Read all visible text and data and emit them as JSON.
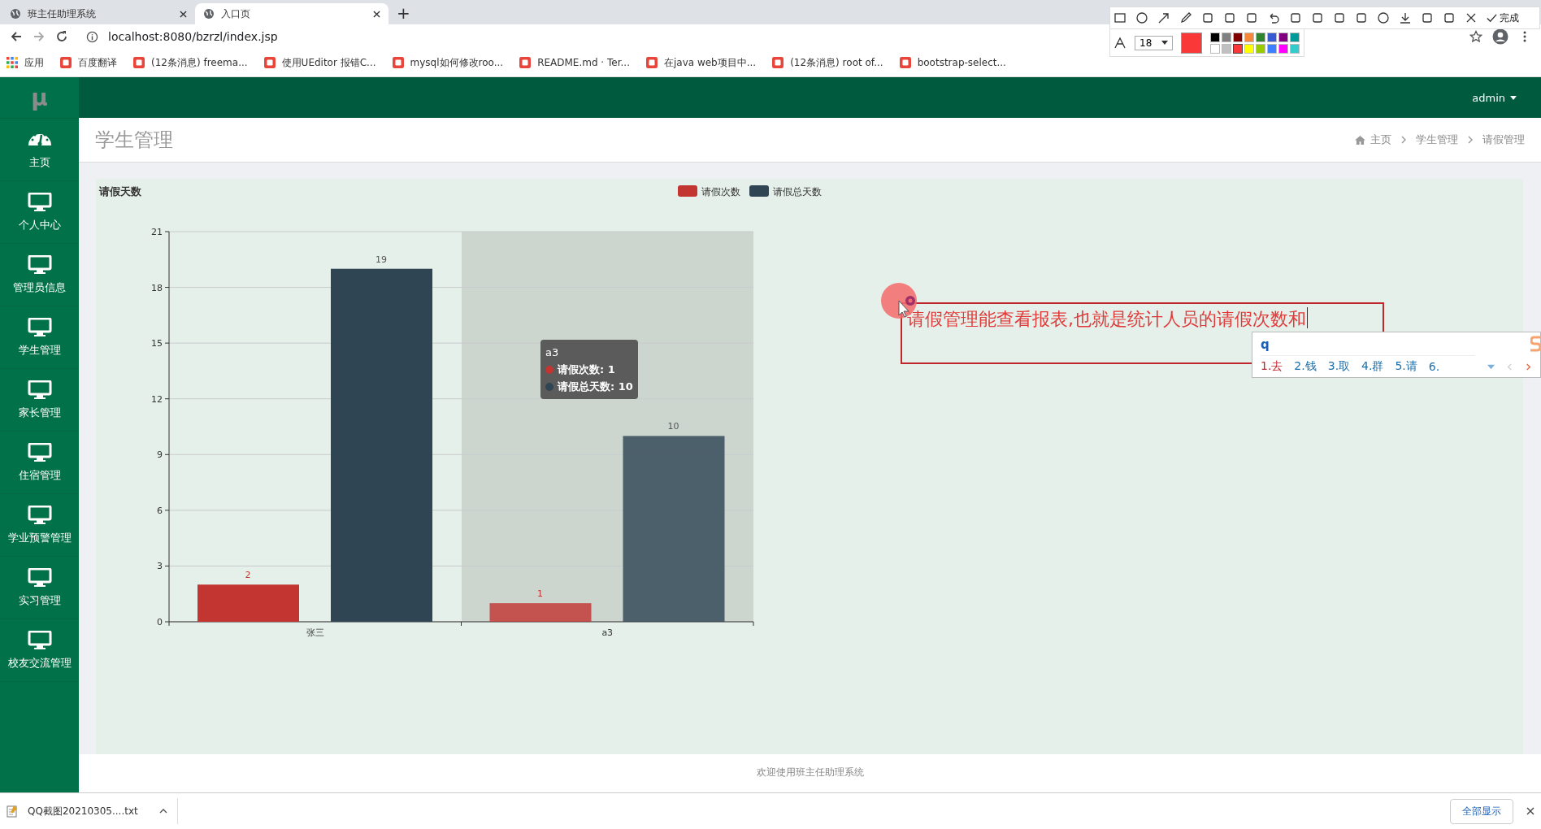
{
  "browser": {
    "tabs": [
      {
        "title": "班主任助理系统",
        "selected": false
      },
      {
        "title": "入口页",
        "selected": true
      }
    ],
    "new_tab": "+",
    "url": "localhost:8080/bzrzl/index.jsp",
    "bookmarks": [
      "应用",
      "百度翻译",
      "(12条消息) freema...",
      "使用UEditor 报错C...",
      "mysql如何修改roo...",
      "README.md · Ter...",
      "在java web项目中...",
      "(12条消息) root of...",
      "bootstrap-select..."
    ]
  },
  "capture_toolbar": {
    "font_size": "18",
    "done": "完成",
    "palette": [
      {
        "color": "#000000",
        "selected": false
      },
      {
        "color": "#808080",
        "selected": false
      },
      {
        "color": "#800000",
        "selected": false
      },
      {
        "color": "#f7883a",
        "selected": false
      },
      {
        "color": "#308430",
        "selected": false
      },
      {
        "color": "#385ad3",
        "selected": false
      },
      {
        "color": "#800080",
        "selected": false
      },
      {
        "color": "#009999",
        "selected": false
      },
      {
        "color": "#ffffff",
        "selected": false
      },
      {
        "color": "#c0c0c0",
        "selected": false
      },
      {
        "color": "#fb3838",
        "selected": true
      },
      {
        "color": "#ffff00",
        "selected": false
      },
      {
        "color": "#99cc00",
        "selected": false
      },
      {
        "color": "#3d80ff",
        "selected": false
      },
      {
        "color": "#ff00ff",
        "selected": false
      },
      {
        "color": "#33cccc",
        "selected": false
      }
    ]
  },
  "app": {
    "logo": "μ",
    "user": "admin",
    "sidebar": [
      {
        "label": "主页",
        "kind": "dashboard"
      },
      {
        "label": "个人中心",
        "kind": "monitor"
      },
      {
        "label": "管理员信息",
        "kind": "monitor"
      },
      {
        "label": "学生管理",
        "kind": "monitor"
      },
      {
        "label": "家长管理",
        "kind": "monitor"
      },
      {
        "label": "住宿管理",
        "kind": "monitor"
      },
      {
        "label": "学业预警管理",
        "kind": "monitor"
      },
      {
        "label": "实习管理",
        "kind": "monitor"
      },
      {
        "label": "校友交流管理",
        "kind": "monitor"
      }
    ],
    "page_title": "学生管理",
    "breadcrumb": [
      "主页",
      "学生管理",
      "请假管理"
    ],
    "chart_data": {
      "type": "bar",
      "title": "请假天数",
      "categories": [
        "张三",
        "a3"
      ],
      "series": [
        {
          "name": "请假次数",
          "color": "#c23531",
          "values": [
            2,
            1
          ]
        },
        {
          "name": "请假总天数",
          "color": "#2f4554",
          "values": [
            19,
            10
          ]
        }
      ],
      "ylim": [
        0,
        21
      ],
      "yticks": [
        0,
        3,
        6,
        9,
        12,
        15,
        18,
        21
      ],
      "data_labels": true,
      "grid": true,
      "legend": true
    },
    "tooltip": {
      "title": "a3",
      "items": [
        {
          "text": "请假次数: 1",
          "color": "#c23531"
        },
        {
          "text": "请假总天数: 10",
          "color": "#2f4554"
        }
      ]
    },
    "footer": "欢迎使用班主任助理系统"
  },
  "annotation": {
    "text": "请假管理能查看报表,也就是统计人员的请假次数和",
    "ime": {
      "input": "q",
      "candidates": [
        "1.去",
        "2.钱",
        "3.取",
        "4.群",
        "5.请",
        "6."
      ]
    }
  },
  "download_bar": {
    "file": "QQ截图20210305....txt",
    "show_all": "全部显示"
  }
}
